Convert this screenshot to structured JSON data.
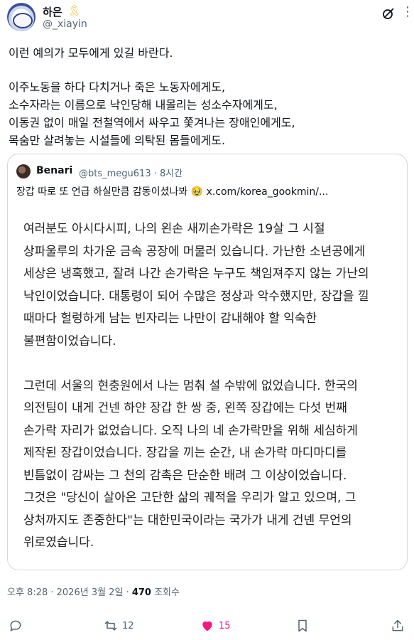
{
  "author": {
    "display_name": "하은",
    "badge_icon": "yellow-ribbon-icon",
    "handle": "@_xiayin"
  },
  "post": {
    "lines_1": [
      "이런 예의가 모두에게 있길 바란다."
    ],
    "lines_2": [
      "이주노동을 하다 다치거나 죽은 노동자에게도,",
      "소수자라는 이름으로 낙인당해 내몰리는 성소수자에게도,",
      "이동권 없이 매일 전철역에서 싸우고 쫓겨나는 장애인에게도,",
      "목숨만 살려놓는 시설들에 의탁된 몸들에게도."
    ]
  },
  "quote": {
    "name": "Benari",
    "meta": "@bts_megu613 · 8시간",
    "text": "장갑 따로 또 언급 하실만큼 감동이셨나봐",
    "emoji": "🥹",
    "link": "x.com/korea_gookmin/...",
    "para_1": [
      "여러분도 아시다시피, 나의 왼손 새끼손가락은 19살 그 시절",
      "상파울루의 차가운 금속 공장에 머물러 있습니다. 가난한 소년공에게",
      "세상은 냉혹했고, 잘려 나간 손가락은 누구도 책임져주지 않는 가난의",
      "낙인이었습니다. 대통령이 되어 수많은 정상과 악수했지만, 장갑을 낄",
      "때마다 헐렁하게 남는 빈자리는 나만이 감내해야 할 익숙한",
      "불편함이었습니다."
    ],
    "para_2": [
      "그런데 서울의 현충원에서 나는 멈춰 설 수밖에 없었습니다. 한국의",
      "의전팀이 내게 건넨 하얀 장갑 한 쌍 중, 왼쪽 장갑에는 다섯 번째",
      "손가락 자리가 없었습니다. 오직 나의 네 손가락만을 위해 세심하게",
      "제작된 장갑이었습니다. 장갑을 끼는 순간, 내 손가락 마디마디를",
      "빈틈없이 감싸는 그 천의 감촉은 단순한 배려 그 이상이었습니다.",
      "그것은 \"당신이 살아온 고단한 삶의 궤적을 우리가 알고 있으며, 그",
      "상처까지도 존중한다\"는 대한민국이라는 국가가 내게 건넨 무언의",
      "위로였습니다."
    ]
  },
  "footer": {
    "timestamp": "오후 8:28 · 2026년 3월 2일 · ",
    "views_count": "470",
    "views_label": " 조회수"
  },
  "actions": {
    "reply_count": "",
    "repost_count": "12",
    "like_count": "15",
    "like_color": "#f91880"
  }
}
